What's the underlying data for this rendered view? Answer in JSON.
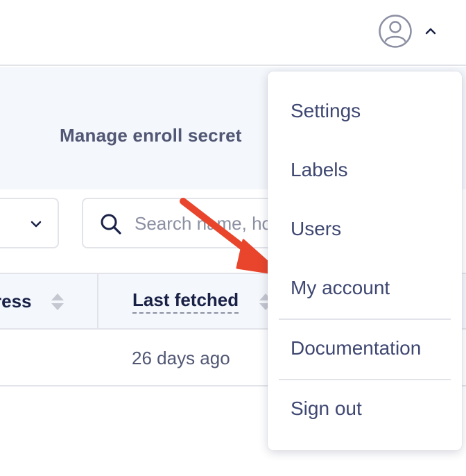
{
  "header": {
    "avatar_icon": "user-circle-icon",
    "menu_toggle_icon": "chevron-up-icon"
  },
  "toolbar": {
    "enroll_secret_label": "Manage enroll secret"
  },
  "filters": {
    "dropdown_icon": "chevron-down-icon",
    "search_icon": "search-icon",
    "search_placeholder": "Search name, hostname, UUID, serial number, or private IP address"
  },
  "table": {
    "columns": [
      {
        "label": "IP address",
        "visible_label": "ress",
        "sortable": true
      },
      {
        "label": "Last fetched",
        "sortable": true
      }
    ],
    "rows": [
      {
        "last_fetched": "26 days ago"
      }
    ]
  },
  "menu": {
    "items": [
      {
        "label": "Settings"
      },
      {
        "label": "Labels"
      },
      {
        "label": "Users"
      },
      {
        "label": "My account"
      },
      {
        "label": "Documentation"
      },
      {
        "label": "Sign out"
      }
    ]
  },
  "annotation": {
    "arrow_color": "#e8452c",
    "target": "My account"
  },
  "colors": {
    "text_primary": "#192147",
    "text_secondary": "#515774",
    "border": "#e2e4ea",
    "band_bg": "#f4f7fb",
    "menu_text": "#3e4771"
  }
}
